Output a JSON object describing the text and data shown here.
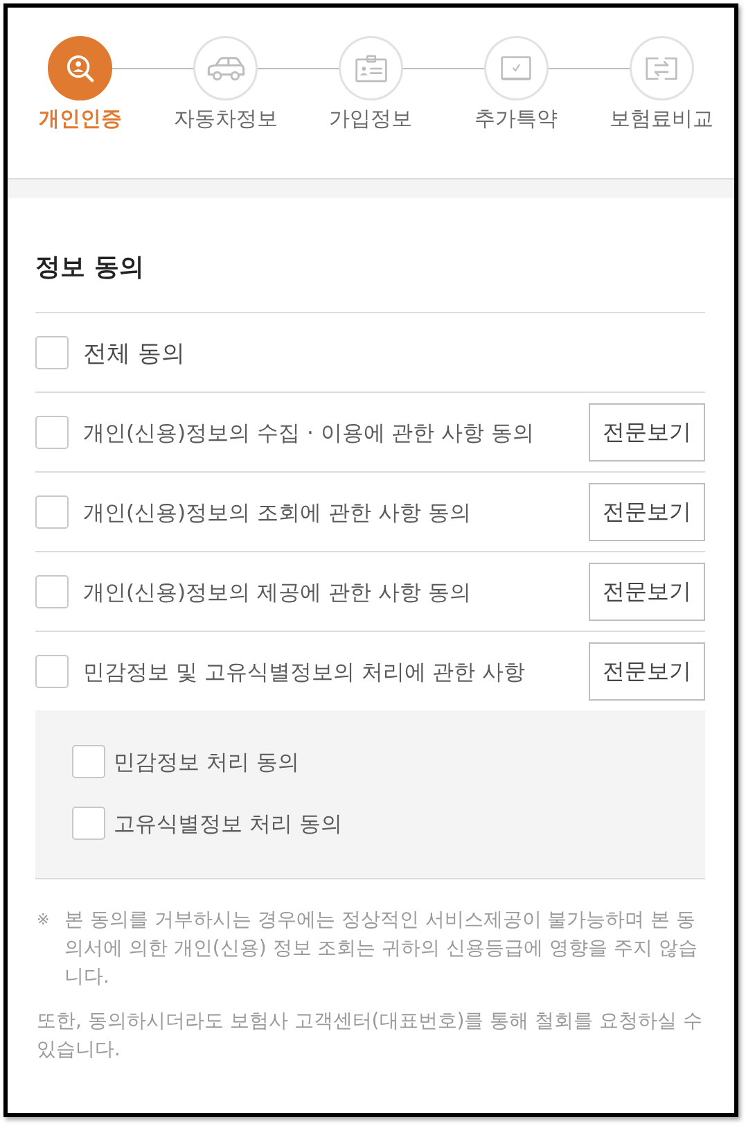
{
  "steps": [
    {
      "label": "개인인증",
      "selected": true
    },
    {
      "label": "자동차정보",
      "selected": false
    },
    {
      "label": "가입정보",
      "selected": false
    },
    {
      "label": "추가특약",
      "selected": false
    },
    {
      "label": "보험료비교",
      "selected": false
    }
  ],
  "section": {
    "title": "정보 동의"
  },
  "agreements": [
    {
      "kind": "all",
      "label": "전체 동의",
      "checked": false
    },
    {
      "kind": "item",
      "label": "개인(신용)정보의 수집 · 이용에 관한 사항 동의",
      "checked": false,
      "button": "전문보기"
    },
    {
      "kind": "item",
      "label": "개인(신용)정보의 조회에 관한 사항 동의",
      "checked": false,
      "button": "전문보기"
    },
    {
      "kind": "item",
      "label": "개인(신용)정보의 제공에 관한 사항 동의",
      "checked": false,
      "button": "전문보기"
    },
    {
      "kind": "item",
      "label": "민감정보 및 고유식별정보의 처리에 관한 사항",
      "checked": false,
      "button": "전문보기",
      "children": [
        {
          "label": "민감정보 처리 동의",
          "checked": false
        },
        {
          "label": "고유식별정보 처리 동의",
          "checked": false
        }
      ]
    }
  ],
  "notice": {
    "mark": "※",
    "text": "본 동의를 거부하시는 경우에는 정상적인 서비스제공이 불가능하며 본 동의서에 의한 개인(신용) 정보 조회는 귀하의 신용등급에 영향을 주지 않습니다."
  },
  "footer_note": "또한, 동의하시더라도 보험사 고객센터(대표번호)를 통해 철회를 요청하실 수 있습니다."
}
